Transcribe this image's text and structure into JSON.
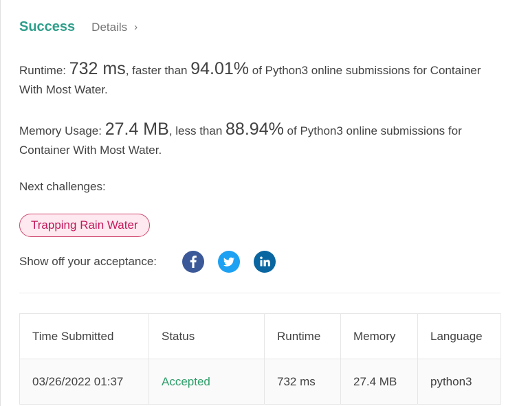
{
  "header": {
    "status": "Success",
    "details_label": "Details",
    "details_chevron": "›"
  },
  "runtime": {
    "prefix": "Runtime: ",
    "value": "732 ms",
    "mid": ", faster than ",
    "percent": "94.01%",
    "suffix": " of Python3 online submissions for Container With Most Water."
  },
  "memory": {
    "prefix": "Memory Usage: ",
    "value": "27.4 MB",
    "mid": ", less than ",
    "percent": "88.94%",
    "suffix": " of Python3 online submissions for Container With Most Water."
  },
  "next": {
    "label": "Next challenges:",
    "challenges": [
      "Trapping Rain Water"
    ]
  },
  "share": {
    "label": "Show off your acceptance:",
    "icons": [
      "facebook-icon",
      "twitter-icon",
      "linkedin-icon"
    ]
  },
  "table": {
    "headers": [
      "Time Submitted",
      "Status",
      "Runtime",
      "Memory",
      "Language"
    ],
    "rows": [
      {
        "time": "03/26/2022 01:37",
        "status": "Accepted",
        "runtime": "732 ms",
        "memory": "27.4 MB",
        "language": "python3"
      }
    ]
  },
  "colors": {
    "success": "#2e9e8a",
    "accepted": "#2e9e6a",
    "pill_border": "#d0476f",
    "pill_bg": "#fde9ef",
    "pill_text": "#c2185b",
    "facebook": "#3b5998",
    "twitter": "#1da1f2",
    "linkedin": "#0a66a0"
  }
}
